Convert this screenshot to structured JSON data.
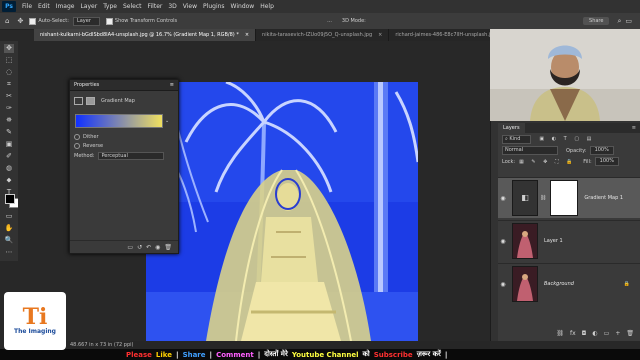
{
  "app": {
    "logo_text": "Ps"
  },
  "menu": [
    "File",
    "Edit",
    "Image",
    "Layer",
    "Type",
    "Select",
    "Filter",
    "3D",
    "View",
    "Plugins",
    "Window",
    "Help"
  ],
  "options_bar": {
    "auto_select_label": "Auto-Select:",
    "auto_select_target": "Layer",
    "show_transform_label": "Show Transform Controls",
    "more_label": "...",
    "mode_label": "3D Mode:",
    "share_label": "Share"
  },
  "tabs": [
    {
      "label": "nishant-kulkarni-bGdlSbd8IA4-unsplash.jpg @ 16.7% (Gradient Map 1, RGB/8) *",
      "active": true
    },
    {
      "label": "nikita-tarasevich-IZUo09j5O_Q-unsplash.jpg",
      "active": false
    },
    {
      "label": "richard-jaimes-486-E8c7lIH-unsplash.jpg",
      "active": false
    }
  ],
  "tools": [
    "✥",
    "⬚",
    "◌",
    "⌗",
    "✂",
    "✑",
    "⛯",
    "✎",
    "▣",
    "✐",
    "◍",
    "⬥",
    "T",
    "↖",
    "▭",
    "✋",
    "🔍",
    "⋯"
  ],
  "properties": {
    "title": "Properties",
    "adjustment": "Gradient Map",
    "gradient_start": "#1030ff",
    "gradient_end": "#f0e060",
    "dither_label": "Dither",
    "reverse_label": "Reverse",
    "method_label": "Method:",
    "method_value": "Perceptual"
  },
  "layers_panel": {
    "title": "Layers",
    "filter_kind": "Kind",
    "blend_mode": "Normal",
    "opacity_label": "Opacity:",
    "opacity_value": "100%",
    "lock_label": "Lock:",
    "fill_label": "Fill:",
    "fill_value": "100%",
    "layers": [
      {
        "name": "Gradient Map 1",
        "active": true
      },
      {
        "name": "Layer 1",
        "active": false
      },
      {
        "name": "Background",
        "active": false
      }
    ]
  },
  "status": {
    "text": "48.667 in x 73 in (72 ppi)"
  },
  "banner": {
    "items": [
      {
        "text": "Please",
        "color": "#ff3030"
      },
      {
        "text": "Like",
        "color": "#ffd000"
      },
      {
        "text": "|",
        "color": "#ffffff"
      },
      {
        "text": "Share",
        "color": "#40a0ff"
      },
      {
        "text": "|",
        "color": "#ffffff"
      },
      {
        "text": "Comment",
        "color": "#ff60ff"
      },
      {
        "text": "|",
        "color": "#ffffff"
      },
      {
        "text": "दोस्तों मेरे",
        "color": "#ffffff"
      },
      {
        "text": "Youtube Channel",
        "color": "#ffff40"
      },
      {
        "text": "को",
        "color": "#ffffff"
      },
      {
        "text": "Subscribe",
        "color": "#ff3030"
      },
      {
        "text": "ज़रूर करें",
        "color": "#ffffff"
      },
      {
        "text": "|",
        "color": "#ffffff"
      }
    ]
  },
  "logo": {
    "mark": "Ti",
    "text": "The Imaging"
  }
}
